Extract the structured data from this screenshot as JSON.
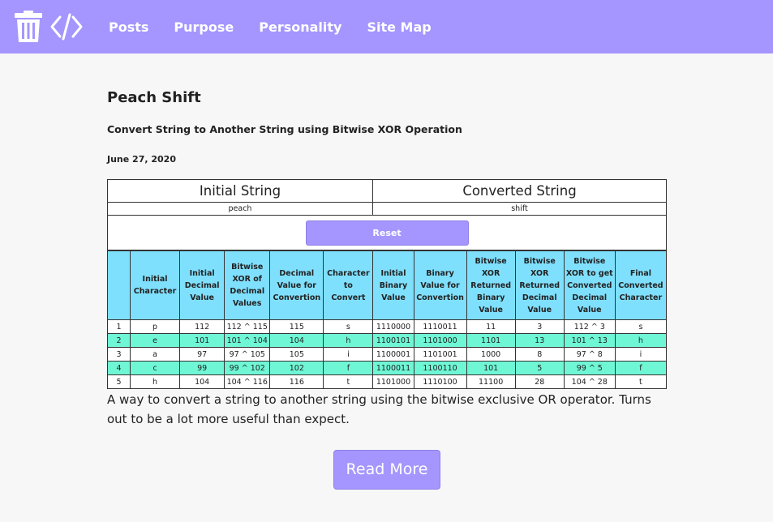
{
  "nav": {
    "links": [
      "Posts",
      "Purpose",
      "Personality",
      "Site Map"
    ]
  },
  "post": {
    "title": "Peach Shift",
    "subtitle": "Convert String to Another String using Bitwise XOR Operation",
    "date": "June 27, 2020",
    "description": "A way to convert a string to another string using the bitwise exclusive OR operator. Turns out to be a lot more useful than expect.",
    "read_more_label": "Read More"
  },
  "widget": {
    "initial_header": "Initial String",
    "converted_header": "Converted String",
    "initial_value": "peach",
    "converted_value": "shift",
    "reset_label": "Reset"
  },
  "table": {
    "columns": [
      "",
      "Initial Character",
      "Initial Decimal Value",
      "Bitwise XOR of Decimal Values",
      "Decimal Value for Convertion",
      "Character to Convert",
      "Initial Binary Value",
      "Binary Value for Convertion",
      "Bitwise XOR Returned Binary Value",
      "Bitwise XOR Returned Decimal Value",
      "Bitwise XOR to get Converted Decimal Value",
      "Final Converted Character"
    ],
    "rows": [
      [
        "1",
        "p",
        "112",
        "112 ^ 115",
        "115",
        "s",
        "1110000",
        "1110011",
        "11",
        "3",
        "112 ^ 3",
        "s"
      ],
      [
        "2",
        "e",
        "101",
        "101 ^ 104",
        "104",
        "h",
        "1100101",
        "1101000",
        "1101",
        "13",
        "101 ^ 13",
        "h"
      ],
      [
        "3",
        "a",
        "97",
        "97 ^ 105",
        "105",
        "i",
        "1100001",
        "1101001",
        "1000",
        "8",
        "97 ^ 8",
        "i"
      ],
      [
        "4",
        "c",
        "99",
        "99 ^ 102",
        "102",
        "f",
        "1100011",
        "1100110",
        "101",
        "5",
        "99 ^ 5",
        "f"
      ],
      [
        "5",
        "h",
        "104",
        "104 ^ 116",
        "116",
        "t",
        "1101000",
        "1110100",
        "11100",
        "28",
        "104 ^ 28",
        "t"
      ]
    ]
  },
  "colors": {
    "accent": "#a496fe",
    "table_header": "#7fe0fd",
    "alt_row": "#6ff7d5"
  },
  "icons": [
    "trash-icon",
    "code-icon"
  ]
}
